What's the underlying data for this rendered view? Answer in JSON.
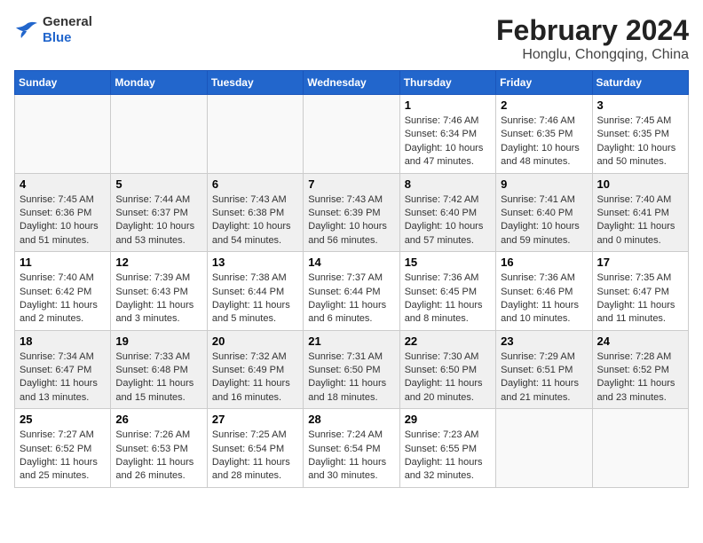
{
  "header": {
    "logo_general": "General",
    "logo_blue": "Blue",
    "title": "February 2024",
    "subtitle": "Honglu, Chongqing, China"
  },
  "weekdays": [
    "Sunday",
    "Monday",
    "Tuesday",
    "Wednesday",
    "Thursday",
    "Friday",
    "Saturday"
  ],
  "weeks": [
    [
      {
        "day": "",
        "info": ""
      },
      {
        "day": "",
        "info": ""
      },
      {
        "day": "",
        "info": ""
      },
      {
        "day": "",
        "info": ""
      },
      {
        "day": "1",
        "info": "Sunrise: 7:46 AM\nSunset: 6:34 PM\nDaylight: 10 hours\nand 47 minutes."
      },
      {
        "day": "2",
        "info": "Sunrise: 7:46 AM\nSunset: 6:35 PM\nDaylight: 10 hours\nand 48 minutes."
      },
      {
        "day": "3",
        "info": "Sunrise: 7:45 AM\nSunset: 6:35 PM\nDaylight: 10 hours\nand 50 minutes."
      }
    ],
    [
      {
        "day": "4",
        "info": "Sunrise: 7:45 AM\nSunset: 6:36 PM\nDaylight: 10 hours\nand 51 minutes."
      },
      {
        "day": "5",
        "info": "Sunrise: 7:44 AM\nSunset: 6:37 PM\nDaylight: 10 hours\nand 53 minutes."
      },
      {
        "day": "6",
        "info": "Sunrise: 7:43 AM\nSunset: 6:38 PM\nDaylight: 10 hours\nand 54 minutes."
      },
      {
        "day": "7",
        "info": "Sunrise: 7:43 AM\nSunset: 6:39 PM\nDaylight: 10 hours\nand 56 minutes."
      },
      {
        "day": "8",
        "info": "Sunrise: 7:42 AM\nSunset: 6:40 PM\nDaylight: 10 hours\nand 57 minutes."
      },
      {
        "day": "9",
        "info": "Sunrise: 7:41 AM\nSunset: 6:40 PM\nDaylight: 10 hours\nand 59 minutes."
      },
      {
        "day": "10",
        "info": "Sunrise: 7:40 AM\nSunset: 6:41 PM\nDaylight: 11 hours\nand 0 minutes."
      }
    ],
    [
      {
        "day": "11",
        "info": "Sunrise: 7:40 AM\nSunset: 6:42 PM\nDaylight: 11 hours\nand 2 minutes."
      },
      {
        "day": "12",
        "info": "Sunrise: 7:39 AM\nSunset: 6:43 PM\nDaylight: 11 hours\nand 3 minutes."
      },
      {
        "day": "13",
        "info": "Sunrise: 7:38 AM\nSunset: 6:44 PM\nDaylight: 11 hours\nand 5 minutes."
      },
      {
        "day": "14",
        "info": "Sunrise: 7:37 AM\nSunset: 6:44 PM\nDaylight: 11 hours\nand 6 minutes."
      },
      {
        "day": "15",
        "info": "Sunrise: 7:36 AM\nSunset: 6:45 PM\nDaylight: 11 hours\nand 8 minutes."
      },
      {
        "day": "16",
        "info": "Sunrise: 7:36 AM\nSunset: 6:46 PM\nDaylight: 11 hours\nand 10 minutes."
      },
      {
        "day": "17",
        "info": "Sunrise: 7:35 AM\nSunset: 6:47 PM\nDaylight: 11 hours\nand 11 minutes."
      }
    ],
    [
      {
        "day": "18",
        "info": "Sunrise: 7:34 AM\nSunset: 6:47 PM\nDaylight: 11 hours\nand 13 minutes."
      },
      {
        "day": "19",
        "info": "Sunrise: 7:33 AM\nSunset: 6:48 PM\nDaylight: 11 hours\nand 15 minutes."
      },
      {
        "day": "20",
        "info": "Sunrise: 7:32 AM\nSunset: 6:49 PM\nDaylight: 11 hours\nand 16 minutes."
      },
      {
        "day": "21",
        "info": "Sunrise: 7:31 AM\nSunset: 6:50 PM\nDaylight: 11 hours\nand 18 minutes."
      },
      {
        "day": "22",
        "info": "Sunrise: 7:30 AM\nSunset: 6:50 PM\nDaylight: 11 hours\nand 20 minutes."
      },
      {
        "day": "23",
        "info": "Sunrise: 7:29 AM\nSunset: 6:51 PM\nDaylight: 11 hours\nand 21 minutes."
      },
      {
        "day": "24",
        "info": "Sunrise: 7:28 AM\nSunset: 6:52 PM\nDaylight: 11 hours\nand 23 minutes."
      }
    ],
    [
      {
        "day": "25",
        "info": "Sunrise: 7:27 AM\nSunset: 6:52 PM\nDaylight: 11 hours\nand 25 minutes."
      },
      {
        "day": "26",
        "info": "Sunrise: 7:26 AM\nSunset: 6:53 PM\nDaylight: 11 hours\nand 26 minutes."
      },
      {
        "day": "27",
        "info": "Sunrise: 7:25 AM\nSunset: 6:54 PM\nDaylight: 11 hours\nand 28 minutes."
      },
      {
        "day": "28",
        "info": "Sunrise: 7:24 AM\nSunset: 6:54 PM\nDaylight: 11 hours\nand 30 minutes."
      },
      {
        "day": "29",
        "info": "Sunrise: 7:23 AM\nSunset: 6:55 PM\nDaylight: 11 hours\nand 32 minutes."
      },
      {
        "day": "",
        "info": ""
      },
      {
        "day": "",
        "info": ""
      }
    ]
  ]
}
